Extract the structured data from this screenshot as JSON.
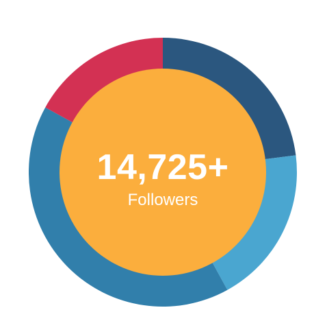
{
  "chart_data": {
    "type": "pie",
    "center_value": "14,725+",
    "center_label": "Followers",
    "slices": [
      {
        "value": 23,
        "color": "#2b577f"
      },
      {
        "value": 19,
        "color": "#4aa6d0"
      },
      {
        "value": 41,
        "color": "#317fab"
      },
      {
        "value": 17,
        "color": "#d33153"
      }
    ],
    "inner_color": "#fbae3d"
  }
}
